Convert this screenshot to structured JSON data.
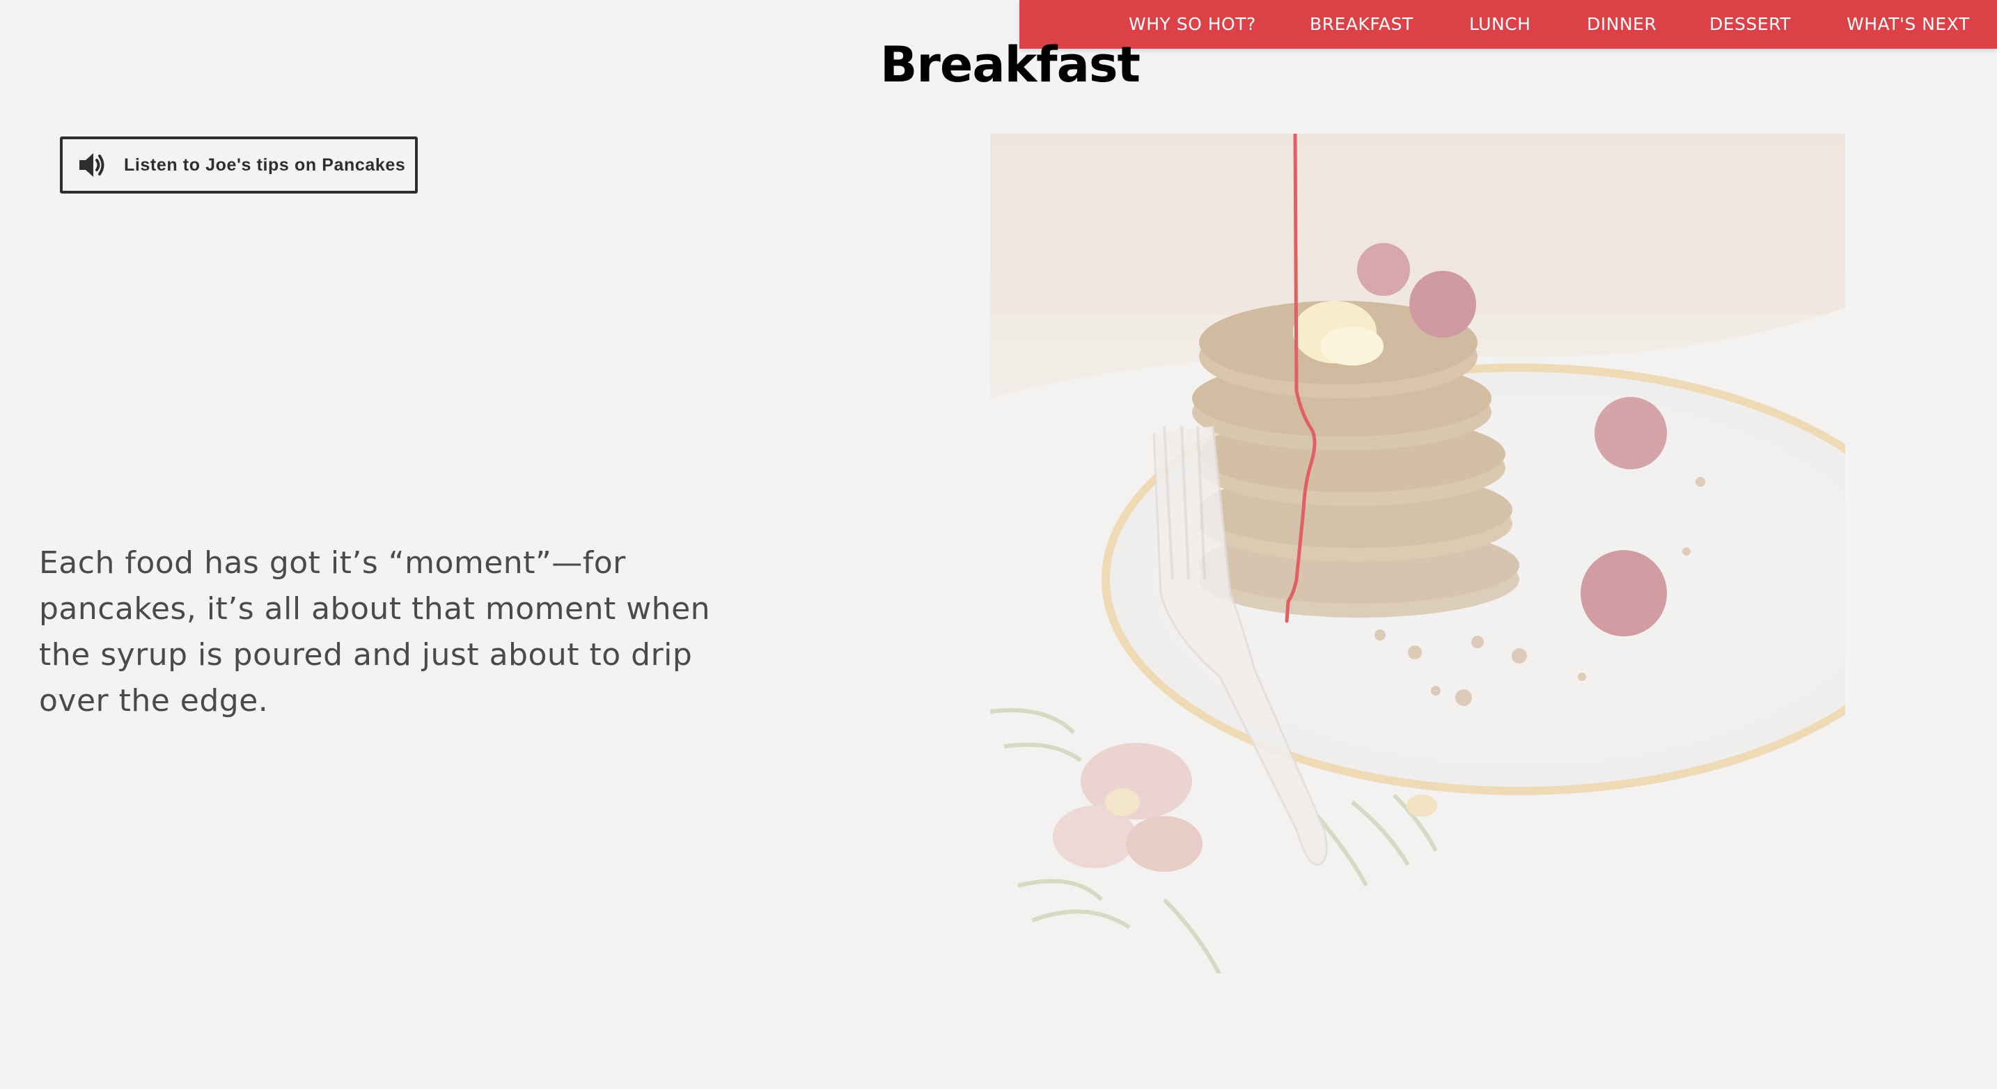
{
  "nav": {
    "items": [
      {
        "label": "WHY SO HOT?"
      },
      {
        "label": "BREAKFAST"
      },
      {
        "label": "LUNCH"
      },
      {
        "label": "DINNER"
      },
      {
        "label": "DESSERT"
      },
      {
        "label": "WHAT'S NEXT"
      }
    ],
    "background_color": "#dc4147"
  },
  "page": {
    "title": "Breakfast"
  },
  "audio": {
    "button_label": "Listen to Joe's tips on Pancakes",
    "icon": "speaker-icon"
  },
  "intro": {
    "text": "Each food has got it’s “moment”—for pancakes, it’s all about that moment when the syrup is poured and just about to drip over the edge."
  },
  "photo": {
    "subject": "pancake-stack-photo",
    "syrup_line_color": "#d62b30"
  }
}
